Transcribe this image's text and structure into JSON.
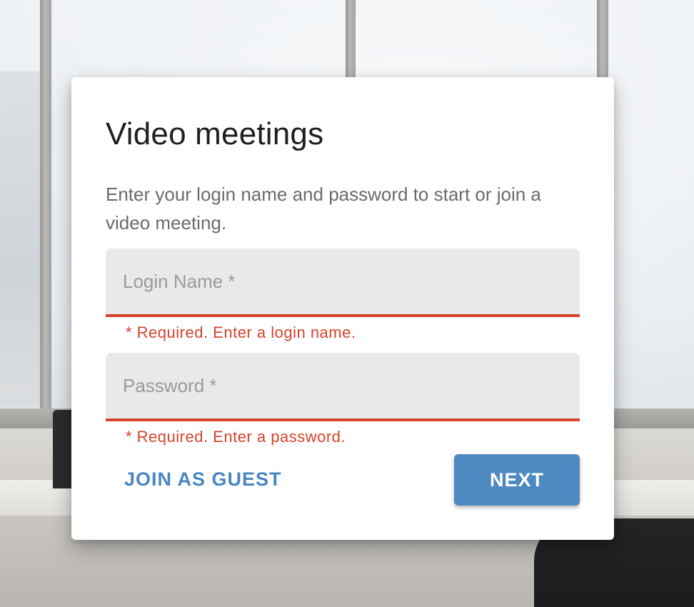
{
  "dialog": {
    "title": "Video meetings",
    "description": "Enter your login name and password to start or join a video meeting."
  },
  "login_field": {
    "placeholder": "Login Name *",
    "value": "",
    "error": "* Required. Enter a login name."
  },
  "password_field": {
    "placeholder": "Password *",
    "value": "",
    "error": "* Required. Enter a password."
  },
  "actions": {
    "guest_label": "JOIN AS GUEST",
    "next_label": "NEXT"
  },
  "colors": {
    "accent": "#4e89c2",
    "link": "#4a86c0",
    "error": "#d5432b",
    "field_bg": "#e9e9e9"
  }
}
